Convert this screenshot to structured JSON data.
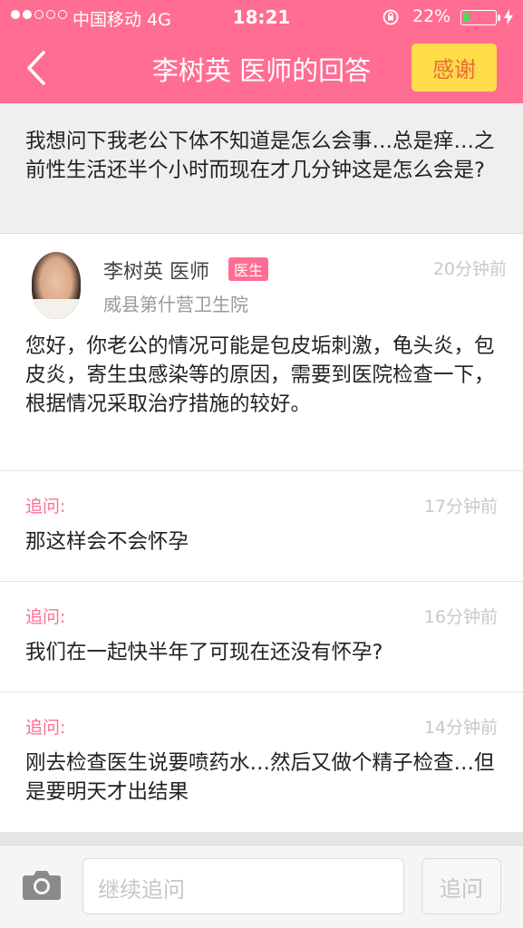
{
  "status_bar": {
    "carrier": "中国移动  4G",
    "time": "18:21",
    "battery_percent": "22%",
    "battery_level": 0.22
  },
  "nav": {
    "title": "李树英 医师的回答",
    "thanks_label": "感谢",
    "back_icon": "chevron-left-icon"
  },
  "question": {
    "text": "我想问下我老公下体不知道是怎么会事…总是痒…之前性生活还半个小时而现在才几分钟这是怎么会是?"
  },
  "answer": {
    "doctor_name": "李树英 医师",
    "badge": "医生",
    "time": "20分钟前",
    "hospital": "威县第什营卫生院",
    "body": "您好，你老公的情况可能是包皮垢刺激，龟头炎，包皮炎，寄生虫感染等的原因，需要到医院检查一下，根据情况采取治疗措施的较好。"
  },
  "followups": [
    {
      "label": "追问:",
      "time": "17分钟前",
      "text": "那这样会不会怀孕"
    },
    {
      "label": "追问:",
      "time": "16分钟前",
      "text": "我们在一起快半年了可现在还没有怀孕?"
    },
    {
      "label": "追问:",
      "time": "14分钟前",
      "text": "刚去检查医生说要喷药水…然后又做个精子检查…但是要明天才出结果"
    }
  ],
  "composer": {
    "placeholder": "继续追问",
    "send_label": "追问",
    "camera_icon": "camera-icon"
  },
  "colors": {
    "brand_pink": "#ff6d93",
    "thanks_yellow": "#ffdc4a",
    "battery_green": "#4cd964"
  }
}
